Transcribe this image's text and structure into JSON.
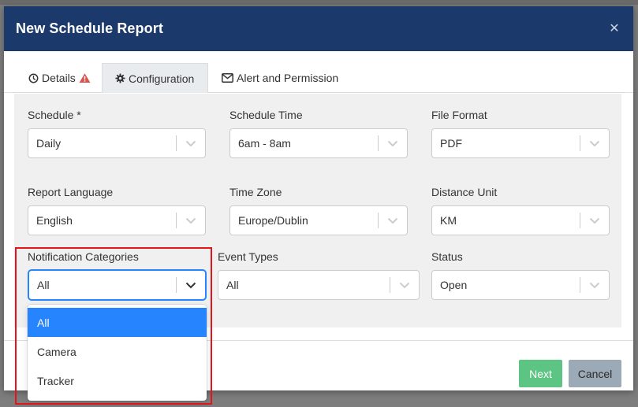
{
  "modal": {
    "title": "New Schedule Report",
    "close_icon": "close-icon"
  },
  "tabs": [
    {
      "label": "Details",
      "icon": "clock-icon",
      "warning_icon": "warning-icon"
    },
    {
      "label": "Configuration",
      "icon": "gear-icon",
      "active": true
    },
    {
      "label": "Alert and Permission",
      "icon": "envelope-icon"
    }
  ],
  "fields": {
    "schedule": {
      "label": "Schedule *",
      "value": "Daily"
    },
    "schedule_time": {
      "label": "Schedule Time",
      "value": "6am - 8am"
    },
    "file_format": {
      "label": "File Format",
      "value": "PDF"
    },
    "report_language": {
      "label": "Report Language",
      "value": "English"
    },
    "time_zone": {
      "label": "Time Zone",
      "value": "Europe/Dublin"
    },
    "distance_unit": {
      "label": "Distance Unit",
      "value": "KM"
    },
    "notification_categories": {
      "label": "Notification Categories",
      "value": "All"
    },
    "event_types": {
      "label": "Event Types",
      "value": "All"
    },
    "status": {
      "label": "Status",
      "value": "Open"
    }
  },
  "dropdown": {
    "options": [
      "All",
      "Camera",
      "Tracker"
    ],
    "selected": "All"
  },
  "footer": {
    "next_label": "Next",
    "cancel_label": "Cancel"
  },
  "colors": {
    "header_bg": "#1b3a6b",
    "next_bg": "#5cc583",
    "cancel_bg": "#9ca9b6",
    "selected_option": "#2684ff",
    "highlight": "#e0161b",
    "warning": "#d9534f"
  }
}
